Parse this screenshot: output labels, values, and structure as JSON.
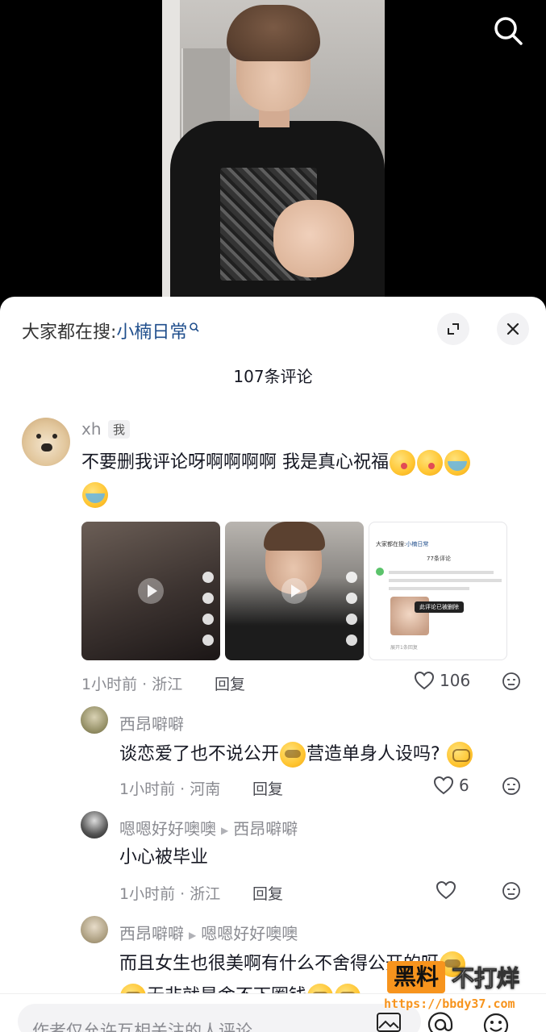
{
  "search_suggestion": {
    "prefix": "大家都在搜:",
    "keyword": "小楠日常"
  },
  "comments_title": "107条评论",
  "comments": {
    "c1": {
      "username": "xh",
      "tag": "我",
      "text_line1": "不要删我评论呀啊啊啊啊 我是真心祝福",
      "meta": "1小时前 · 浙江",
      "reply_label": "回复",
      "likes": "106"
    },
    "c2": {
      "username": "西昂噼噼",
      "text_a": "谈恋爱了也不说公开",
      "text_b": "营造单身人设吗?",
      "meta": "1小时前 · 河南",
      "reply_label": "回复",
      "likes": "6"
    },
    "c3": {
      "username": "嗯嗯好好噢噢",
      "reply_to": "西昂噼噼",
      "text": "小心被毕业",
      "meta": "1小时前 · 浙江",
      "reply_label": "回复"
    },
    "c4": {
      "username": "西昂噼噼",
      "reply_to": "嗯嗯好好噢噢",
      "text_line1": "而且女生也很美啊有什么不舍得公开的呀",
      "text_line2": "无非就是舍不下圈钱"
    }
  },
  "screenshot_thumb": {
    "search_prefix": "大家都在搜:",
    "keyword": "小楠日常",
    "count": "77条评论",
    "deleted_notice": "此评论已被删除",
    "expand": "展开1条回复"
  },
  "input_placeholder": "作者仅允许互相关注的人评论",
  "watermark": {
    "brand": "黑料",
    "slogan": "不打烊",
    "url": "https://bbdy37.com"
  },
  "colors": {
    "keyword_blue": "#1f4e8c",
    "meta_gray": "#8a8b91",
    "watermark_orange": "#f7941d"
  }
}
